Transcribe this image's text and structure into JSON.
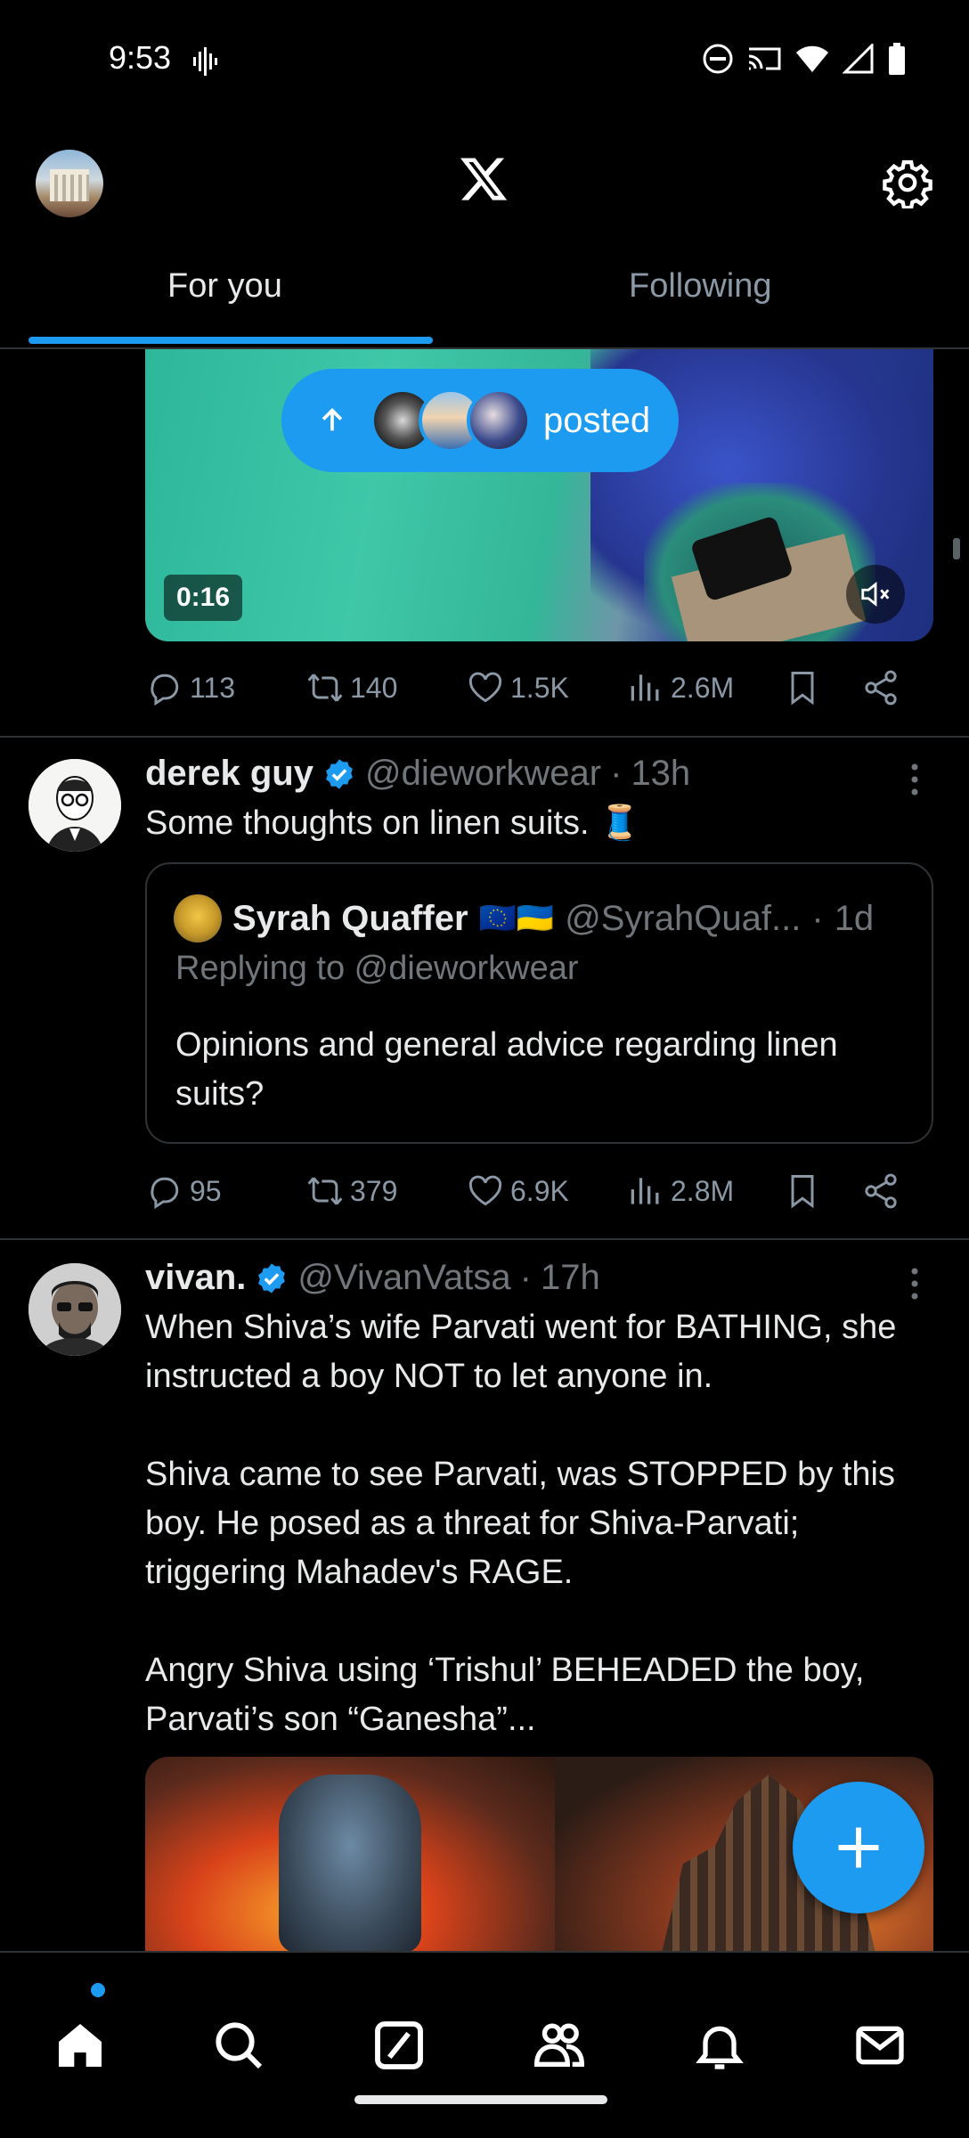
{
  "status_bar": {
    "time": "9:53"
  },
  "header": {
    "logo": "x-logo-icon",
    "settings": "gear-icon"
  },
  "tabs": [
    {
      "label": "For you",
      "active": true
    },
    {
      "label": "Following",
      "active": false
    }
  ],
  "colors": {
    "accent": "#1d9bf0",
    "background": "#000000",
    "muted": "#71767b",
    "divider": "#2f3336"
  },
  "top_post": {
    "video_duration": "0:16",
    "new_posts_pill": "posted",
    "stats": {
      "replies": "113",
      "reposts": "140",
      "likes": "1.5K",
      "views": "2.6M"
    }
  },
  "post1": {
    "name": "derek guy",
    "handle": "@dieworkwear",
    "dot": "·",
    "time": "13h",
    "text": "Some thoughts on linen suits. 🧵",
    "quote": {
      "name": "Syrah Quaffer",
      "flags": "🇪🇺🇺🇦",
      "handle": "@SyrahQuaf...",
      "dot": "·",
      "time": "1d",
      "reply_to": "Replying to @dieworkwear",
      "text": "Opinions and general advice regarding linen suits?"
    },
    "stats": {
      "replies": "95",
      "reposts": "379",
      "likes": "6.9K",
      "views": "2.8M"
    }
  },
  "post2": {
    "name": "vivan.",
    "handle": "@VivanVatsa",
    "dot": "·",
    "time": "17h",
    "text": "When Shiva’s wife Parvati went for BATHING, she instructed a boy NOT to let anyone in.\n\nShiva came to see Parvati, was STOPPED by this boy. He posed as a threat for Shiva-Parvati; triggering Mahadev's RAGE.\n\nAngry Shiva using ‘Trishul’ BEHEADED the boy, Parvati’s son “Ganesha”..."
  },
  "bottom_nav": [
    "home-icon",
    "search-icon",
    "grok-icon",
    "communities-icon",
    "notifications-icon",
    "messages-icon"
  ]
}
